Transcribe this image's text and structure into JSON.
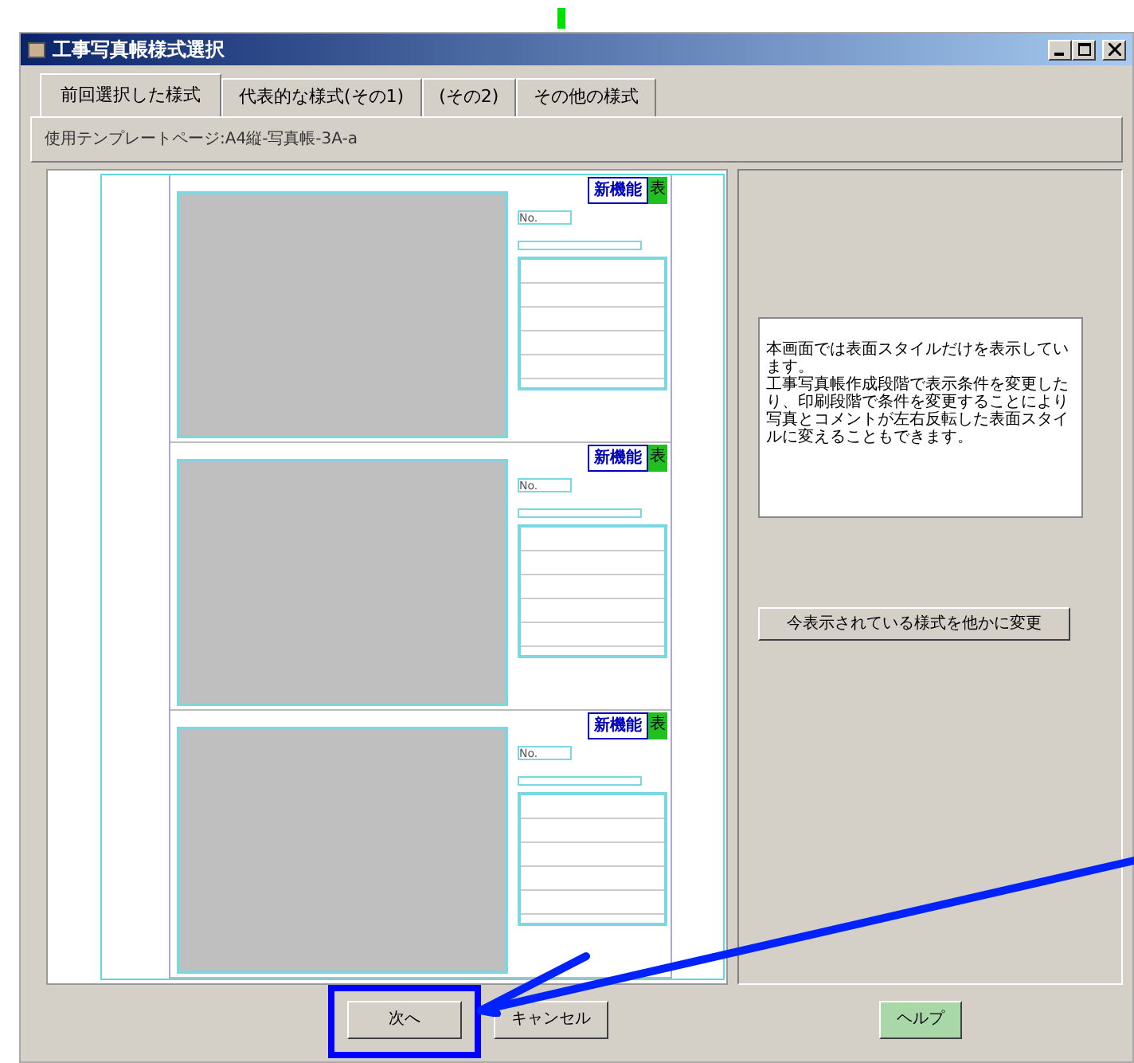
{
  "window": {
    "title": "工事写真帳様式選択"
  },
  "tabs": [
    {
      "label": "前回選択した様式",
      "selected": true
    },
    {
      "label": "代表的な様式(その1)",
      "selected": false
    },
    {
      "label": "(その2)",
      "selected": false
    },
    {
      "label": "その他の様式",
      "selected": false
    }
  ],
  "template_label": "使用テンプレートページ:A4縦-写真帳-3A-a",
  "preview": {
    "sections": [
      {
        "number_label": "No.",
        "tag": "新機能",
        "tag_mark": "表"
      },
      {
        "number_label": "No.",
        "tag": "新機能",
        "tag_mark": "表"
      },
      {
        "number_label": "No.",
        "tag": "新機能",
        "tag_mark": "表"
      }
    ]
  },
  "info_text": [
    "本画面では表面スタイルだけを表示しています。",
    "工事写真帳作成段階で表示条件を変更したり、印刷段階で条件を変更することにより写真とコメントが左右反転した表面スタイルに変えることもできます。"
  ],
  "change_button": "今表示されている様式を他かに変更",
  "buttons": [
    {
      "label": "次へ",
      "highlighted": true
    },
    {
      "label": "キャンセル",
      "highlighted": false
    },
    {
      "label": "ヘルプ",
      "highlighted": false
    }
  ]
}
